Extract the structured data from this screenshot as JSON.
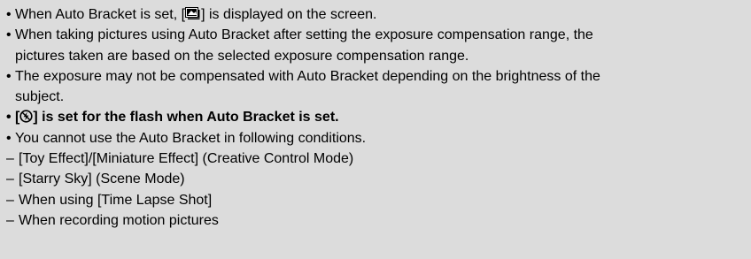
{
  "bullets": [
    {
      "before_icon": "When Auto Bracket is set, [",
      "icon": "auto-bracket-icon",
      "after_icon": "] is displayed on the screen."
    },
    {
      "line1": "When taking pictures using Auto Bracket after setting the exposure compensation range, the",
      "line2": "pictures taken are based on the selected exposure compensation range."
    },
    {
      "line1": "The exposure may not be compensated with Auto Bracket depending on the brightness of the",
      "line2": "subject."
    },
    {
      "before_icon": "[",
      "icon": "flash-off-icon",
      "after_icon": "] is set for the flash when Auto Bracket is set."
    },
    {
      "text": "You cannot use the Auto Bracket in following conditions.",
      "sub_items": [
        "[Toy Effect]/[Miniature Effect] (Creative Control Mode)",
        "[Starry Sky] (Scene Mode)",
        "When using [Time Lapse Shot]",
        "When recording motion pictures"
      ]
    }
  ],
  "bullet_char": "•",
  "dash_char": "–"
}
